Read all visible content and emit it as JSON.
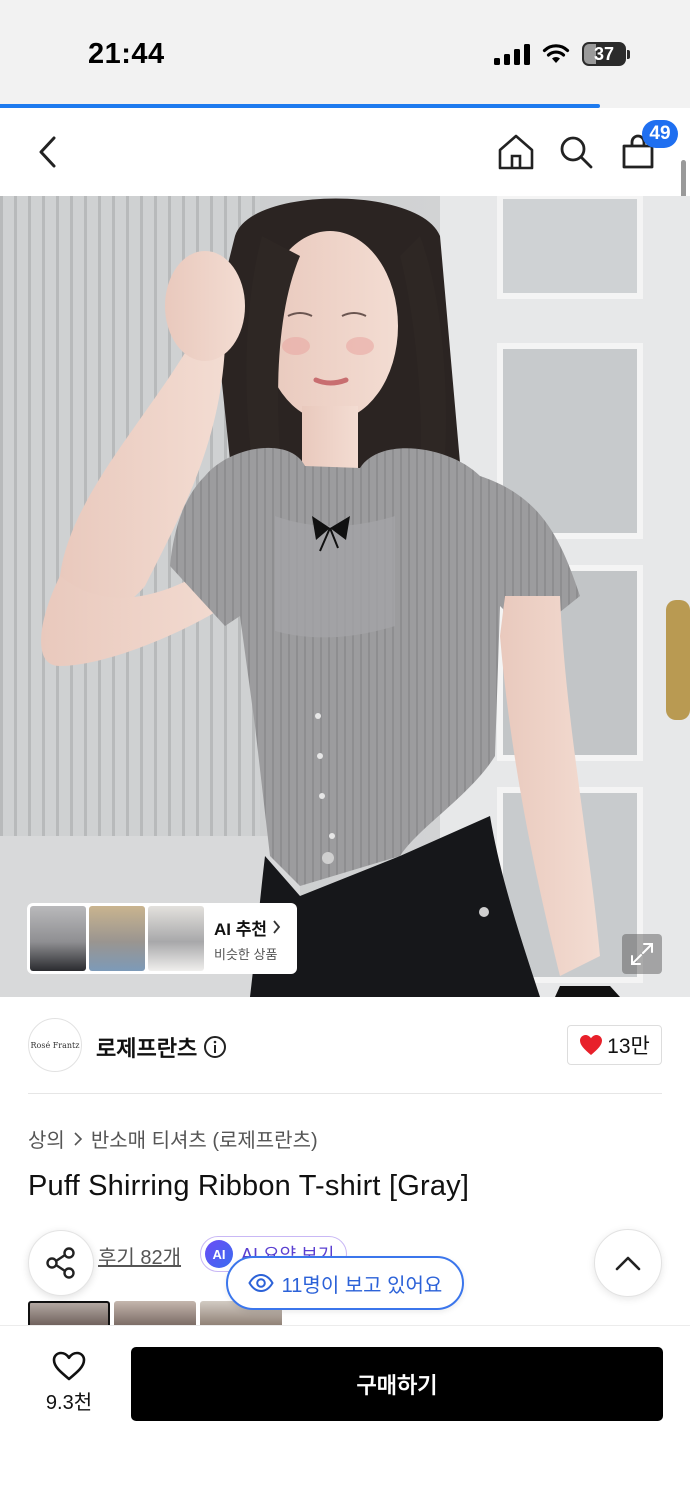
{
  "status_bar": {
    "time": "21:44",
    "battery": "37",
    "battery_level": 0.37
  },
  "page_progress": 0.87,
  "nav": {
    "back_icon": "chevron-left-icon",
    "home_icon": "home-icon",
    "search_icon": "search-icon",
    "cart_icon": "shopping-bag-icon",
    "cart_count": "49"
  },
  "ai_recommend": {
    "title": "AI 추천",
    "subtitle": "비슷한 상품"
  },
  "brand": {
    "logo_text": "Rosé Frantz",
    "name": "로제프란츠",
    "likes": "13만"
  },
  "breadcrumb": {
    "category": "상의",
    "subcategory": "반소매 티셔츠 (로제프란츠)"
  },
  "product": {
    "title": "Puff Shirring Ribbon T-shirt [Gray]"
  },
  "reviews": {
    "link": "후기 82개",
    "ai_badge": "AI",
    "ai_summary": "AI 요약 보기"
  },
  "viewers": {
    "text": "11명이 보고 있어요"
  },
  "bottom": {
    "wish_count": "9.3천",
    "buy_label": "구매하기"
  },
  "colors": {
    "accent_blue": "#1f6ff0",
    "heart_red": "#e8202a",
    "buy_black": "#000000"
  }
}
